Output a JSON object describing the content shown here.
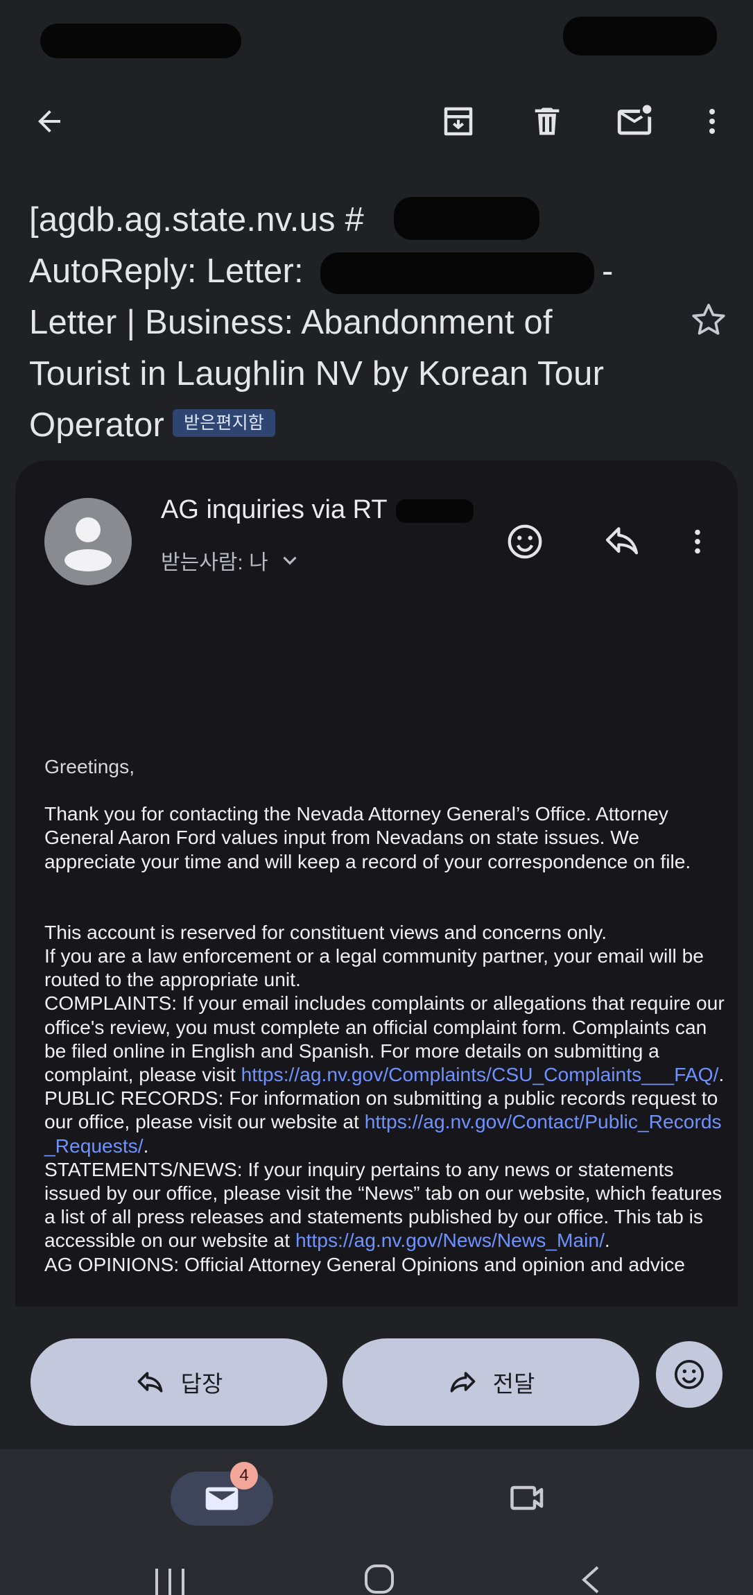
{
  "app_bar": {
    "back_label": "back",
    "archive_label": "archive",
    "delete_label": "delete",
    "mark_unread_label": "mark unread",
    "more_label": "more options"
  },
  "email": {
    "subject_lines": [
      "[agdb.ag.state.nv.us #",
      "AutoReply: Letter: ",
      "Letter | Business: Abandonment of",
      "Tourist in Laughlin NV by Korean Tour",
      "Operator"
    ],
    "subject_dash": "-",
    "label_badge": "받은편지함",
    "sender": "AG inquiries via RT",
    "recipient": "받는사람: 나",
    "greeting": "Greetings,",
    "para1": "Thank you for contacting the Nevada Attorney General’s Office. Attorney General Aaron Ford values input from Nevadans on state issues. We appreciate your time and will keep a record of your correspondence on file.",
    "line_account": "This account is reserved for constituent views and concerns only.",
    "line_law": "If you are a law enforcement or a legal community partner, your email will be routed to the appropriate unit.",
    "complaints_text": "COMPLAINTS: If your email includes complaints or allegations that require our office's review, you must complete an official complaint form. Complaints can be filed online in English and Spanish. For more details on submitting a complaint, please visit ",
    "complaints_link": "https://ag.nv.gov/Complaints/CSU_Complaints___FAQ/",
    "records_text": "PUBLIC RECORDS: For information on submitting a public records request to our office, please visit our website at ",
    "records_link": "https://ag.nv.gov/Contact/Public_Records_Requests/",
    "news_text": "STATEMENTS/NEWS: If your inquiry pertains to any news or statements issued by our office, please visit the “News” tab on our website, which features a list of all press releases and statements published by our office. This tab is accessible on our website at ",
    "news_link": "https://ag.nv.gov/News/News_Main/",
    "period": ".",
    "cut_line": "AG OPINIONS: Official Attorney General Opinions and opinion and advice"
  },
  "actions": {
    "reply": "답장",
    "forward": "전달"
  },
  "bottom_nav": {
    "mail_badge": "4"
  },
  "colors": {
    "background": "#202125",
    "card": "#17171b",
    "link": "#6e92ff",
    "pill": "#c4c8dc",
    "badge": "#f3a79b"
  }
}
